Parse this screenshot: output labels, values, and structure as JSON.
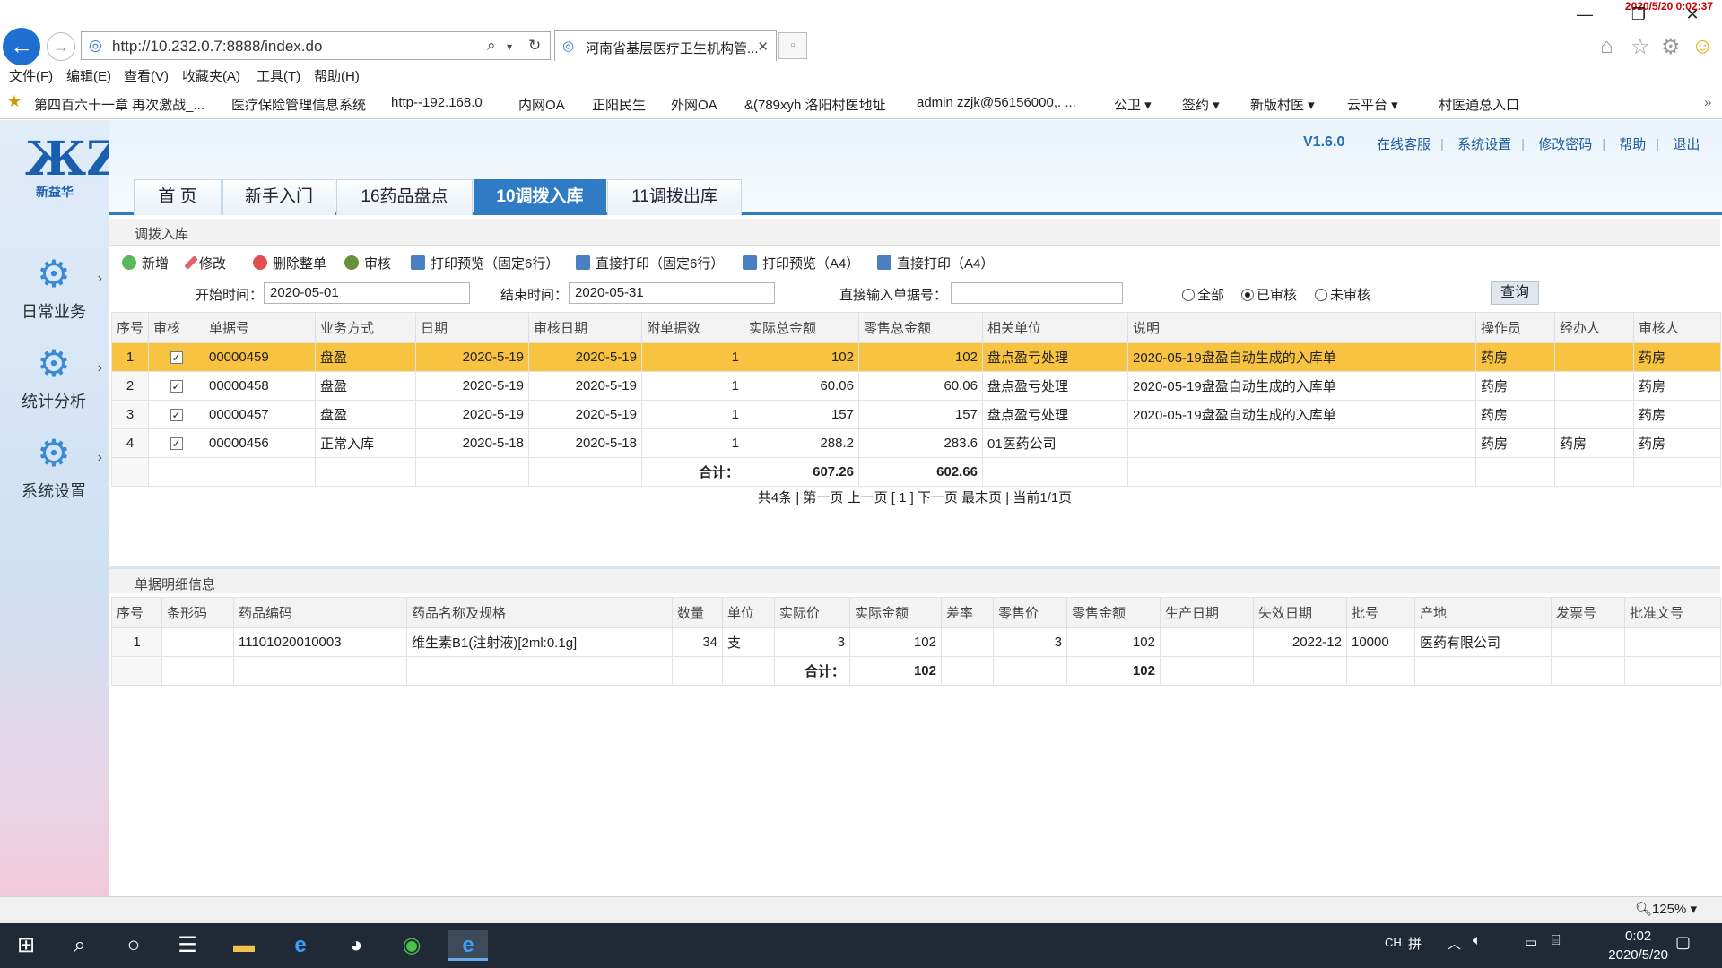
{
  "browser": {
    "clock_overlay": "2020/5/20 0:02:37",
    "url": "http://10.232.0.7:8888/index.do",
    "tab_title": "河南省基层医疗卫生机构管...",
    "menu": [
      "文件(F)",
      "编辑(E)",
      "查看(V)",
      "收藏夹(A)",
      "工具(T)",
      "帮助(H)"
    ],
    "favorites": [
      "第四百六十一章 再次激战_...",
      "医疗保险管理信息系统",
      "http--192.168.0",
      "内网OA",
      "正阳民生",
      "外网OA",
      "&(789xyh 洛阳村医地址",
      "admin zzjk@56156000,. ...",
      "公卫 ▾",
      "签约 ▾",
      "新版村医 ▾",
      "云平台 ▾",
      "村医通总入口"
    ],
    "zoom": "125%"
  },
  "app": {
    "logo_text": "新益华",
    "version": "V1.6.0",
    "top_links": [
      "在线客服",
      "系统设置",
      "修改密码",
      "帮助",
      "退出"
    ],
    "nav": [
      {
        "label": "日常业务",
        "icon": "gear-icon"
      },
      {
        "label": "统计分析",
        "icon": "gear-icon"
      },
      {
        "label": "系统设置",
        "icon": "gear-icon"
      }
    ],
    "tabs": [
      "首 页",
      "新手入门",
      "16药品盘点",
      "10调拨入库",
      "11调拨出库"
    ],
    "active_tab": "10调拨入库",
    "panel1_title": "调拨入库",
    "toolbar": [
      "新增",
      "修改",
      "删除整单",
      "审核",
      "打印预览（固定6行）",
      "直接打印（固定6行）",
      "打印预览（A4）",
      "直接打印（A4）"
    ],
    "filters": {
      "start_label": "开始时间：",
      "start_value": "2020-05-01",
      "end_label": "结束时间：",
      "end_value": "2020-05-31",
      "doc_label": "直接输入单据号：",
      "doc_value": "",
      "radios": [
        "全部",
        "已审核",
        "未审核"
      ],
      "radio_selected": "已审核",
      "query": "查询"
    },
    "main_table": {
      "headers": [
        "序号",
        "审核",
        "单据号",
        "业务方式",
        "日期",
        "审核日期",
        "附单据数",
        "实际总金额",
        "零售总金额",
        "相关单位",
        "说明",
        "操作员",
        "经办人",
        "审核人"
      ],
      "rows": [
        [
          "1",
          "✓",
          "00000459",
          "盘盈",
          "2020-5-19",
          "2020-5-19",
          "1",
          "102",
          "102",
          "盘点盈亏处理",
          "2020-05-19盘盈自动生成的入库单",
          "药房",
          "",
          "药房"
        ],
        [
          "2",
          "✓",
          "00000458",
          "盘盈",
          "2020-5-19",
          "2020-5-19",
          "1",
          "60.06",
          "60.06",
          "盘点盈亏处理",
          "2020-05-19盘盈自动生成的入库单",
          "药房",
          "",
          "药房"
        ],
        [
          "3",
          "✓",
          "00000457",
          "盘盈",
          "2020-5-19",
          "2020-5-19",
          "1",
          "157",
          "157",
          "盘点盈亏处理",
          "2020-05-19盘盈自动生成的入库单",
          "药房",
          "",
          "药房"
        ],
        [
          "4",
          "✓",
          "00000456",
          "正常入库",
          "2020-5-18",
          "2020-5-18",
          "1",
          "288.2",
          "283.6",
          "01医药公司",
          "",
          "药房",
          "药房",
          "药房"
        ]
      ],
      "total_label": "合计：",
      "total_actual": "607.26",
      "total_retail": "602.66"
    },
    "pager": "共4条 | 第一页  上一页  [ 1 ]  下一页  最末页 | 当前1/1页",
    "panel2_title": "单据明细信息",
    "detail_table": {
      "headers": [
        "序号",
        "条形码",
        "药品编码",
        "药品名称及规格",
        "数量",
        "单位",
        "实际价",
        "实际金额",
        "差率",
        "零售价",
        "零售金额",
        "生产日期",
        "失效日期",
        "批号",
        "产地",
        "发票号",
        "批准文号"
      ],
      "rows": [
        [
          "1",
          "",
          "11101020010003",
          "维生素B1(注射液)[2ml:0.1g]",
          "34",
          "支",
          "3",
          "102",
          "",
          "3",
          "102",
          "",
          "2022-12",
          "10000",
          "医药有限公司",
          "",
          ""
        ]
      ],
      "total_label": "合计：",
      "total_actual": "102",
      "total_retail": "102"
    }
  },
  "taskbar": {
    "ime": "CH",
    "ime2": "拼",
    "time": "0:02",
    "date": "2020/5/20"
  },
  "colors": {
    "accent": "#2f7cc4",
    "selected_row": "#f7c341",
    "taskbar": "#1f2a36"
  }
}
